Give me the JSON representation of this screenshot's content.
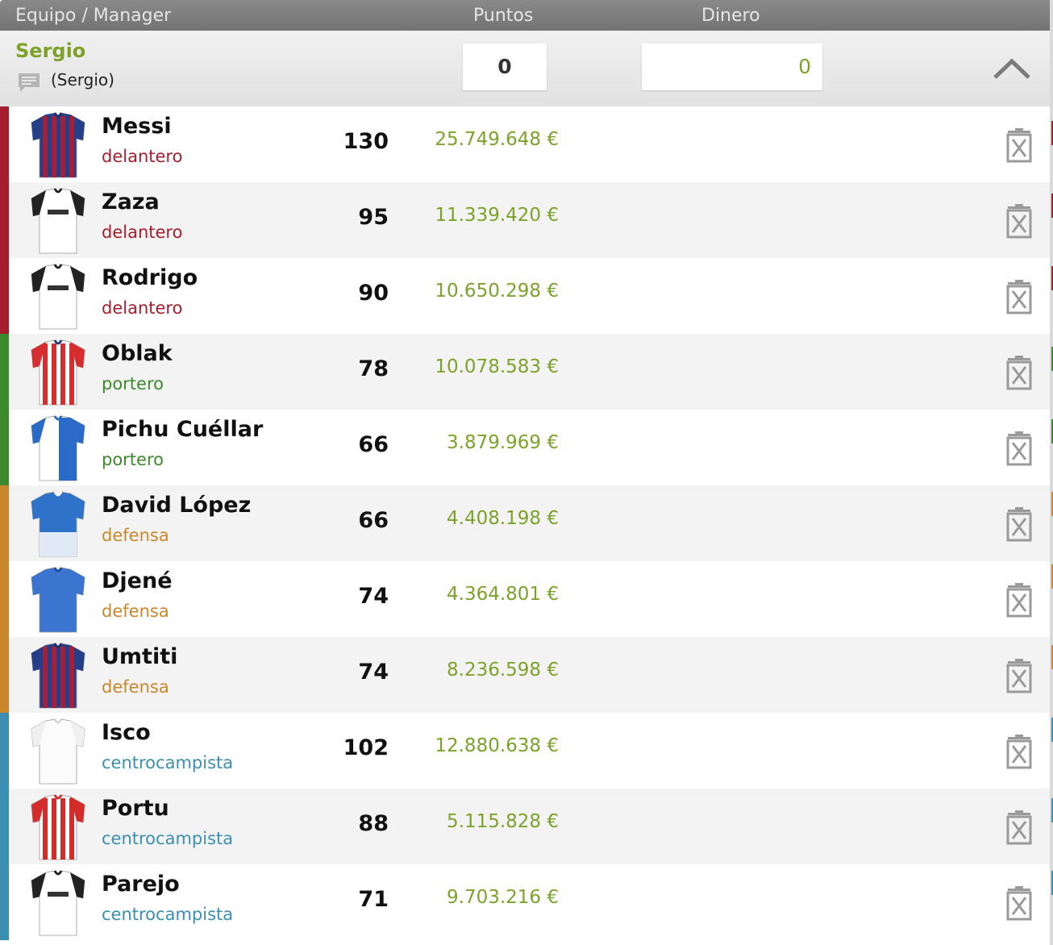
{
  "header": {
    "team_manager_label": "Equipo / Manager",
    "points_label": "Puntos",
    "money_label": "Dinero"
  },
  "team": {
    "name": "Sergio",
    "manager": "(Sergio)",
    "points_value": "0",
    "money_value": "0",
    "icons": {
      "chat": "chat-bubble-icon",
      "collapse": "chevron-up-icon",
      "remove": "trash-icon"
    }
  },
  "position_colors": {
    "delantero": "#a51e2e",
    "portero": "#3b8a2c",
    "defensa": "#c9862b",
    "centrocampista": "#3b8fb0"
  },
  "players": [
    {
      "name": "Messi",
      "position": "delantero",
      "points": "130",
      "value": "25.749.648 €",
      "jersey": "barcelona"
    },
    {
      "name": "Zaza",
      "position": "delantero",
      "points": "95",
      "value": "11.339.420 €",
      "jersey": "valencia"
    },
    {
      "name": "Rodrigo",
      "position": "delantero",
      "points": "90",
      "value": "10.650.298 €",
      "jersey": "valencia"
    },
    {
      "name": "Oblak",
      "position": "portero",
      "points": "78",
      "value": "10.078.583 €",
      "jersey": "atletico"
    },
    {
      "name": "Pichu Cuéllar",
      "position": "portero",
      "points": "66",
      "value": "3.879.969 €",
      "jersey": "leganes"
    },
    {
      "name": "David López",
      "position": "defensa",
      "points": "66",
      "value": "4.408.198 €",
      "jersey": "espanyol"
    },
    {
      "name": "Djené",
      "position": "defensa",
      "points": "74",
      "value": "4.364.801 €",
      "jersey": "getafe"
    },
    {
      "name": "Umtiti",
      "position": "defensa",
      "points": "74",
      "value": "8.236.598 €",
      "jersey": "barcelona"
    },
    {
      "name": "Isco",
      "position": "centrocampista",
      "points": "102",
      "value": "12.880.638 €",
      "jersey": "realmadrid"
    },
    {
      "name": "Portu",
      "position": "centrocampista",
      "points": "88",
      "value": "5.115.828 €",
      "jersey": "girona"
    },
    {
      "name": "Parejo",
      "position": "centrocampista",
      "points": "71",
      "value": "9.703.216 €",
      "jersey": "valencia"
    }
  ]
}
